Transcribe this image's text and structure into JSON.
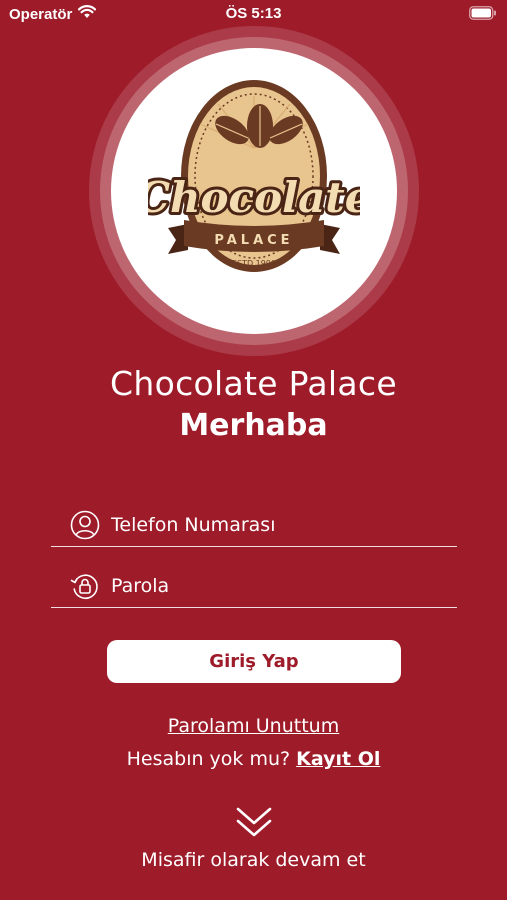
{
  "status_bar": {
    "carrier": "Operatör",
    "time": "ÖS 5:13"
  },
  "logo": {
    "script_text": "Chocolate",
    "banner_text": "PALACE",
    "established_text": "ESTD 1999"
  },
  "header": {
    "app_name": "Chocolate Palace",
    "greeting": "Merhaba"
  },
  "form": {
    "phone_placeholder": "Telefon Numarası",
    "password_placeholder": "Parola",
    "login_label": "Giriş Yap"
  },
  "links": {
    "forgot_password": "Parolamı Unuttum",
    "no_account": "Hesabın yok mu? ",
    "register": "Kayıt Ol",
    "guest": "Misafir olarak devam et"
  },
  "colors": {
    "background": "#9e1b2a",
    "logo_brown": "#6b3a22",
    "logo_tan": "#e8c48f"
  },
  "icons": [
    "wifi-icon",
    "battery-icon",
    "user-icon",
    "lock-rotate-icon",
    "double-chevron-down-icon"
  ]
}
